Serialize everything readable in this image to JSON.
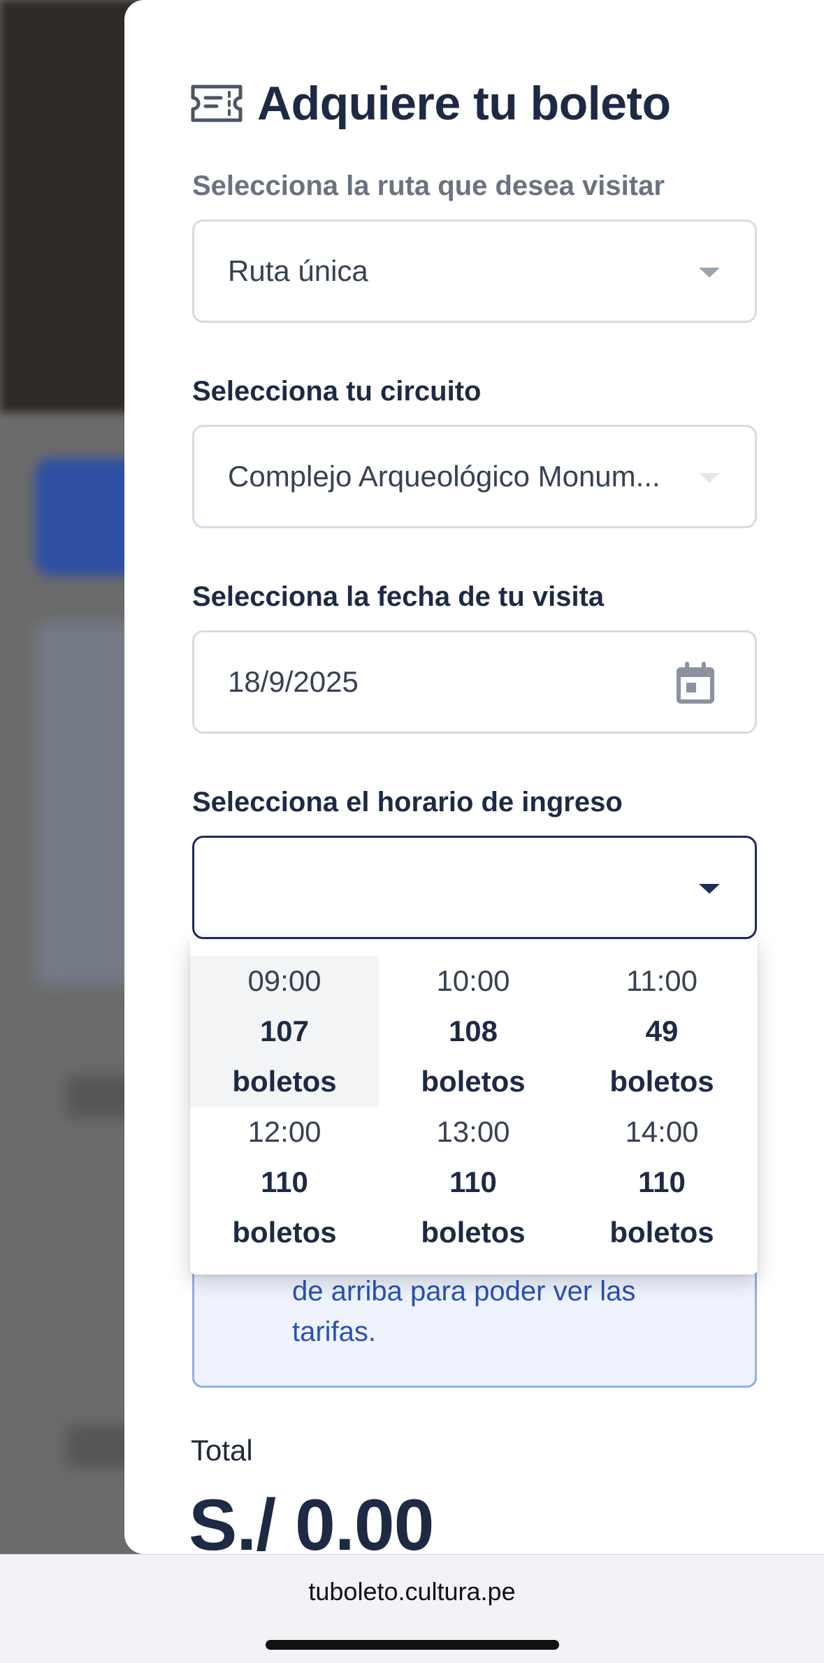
{
  "modal": {
    "title": "Adquiere tu boleto",
    "route": {
      "label": "Selecciona la ruta que desea visitar",
      "value": "Ruta única"
    },
    "circuit": {
      "label": "Selecciona tu circuito",
      "value": "Complejo Arqueológico Monum..."
    },
    "date": {
      "label": "Selecciona la fecha de tu visita",
      "value": "18/9/2025"
    },
    "schedule": {
      "label": "Selecciona el horario de ingreso",
      "value": "",
      "options": [
        {
          "time": "09:00",
          "count": "107",
          "unit": "boletos"
        },
        {
          "time": "10:00",
          "count": "108",
          "unit": "boletos"
        },
        {
          "time": "11:00",
          "count": "49",
          "unit": "boletos"
        },
        {
          "time": "12:00",
          "count": "110",
          "unit": "boletos"
        },
        {
          "time": "13:00",
          "count": "110",
          "unit": "boletos"
        },
        {
          "time": "14:00",
          "count": "110",
          "unit": "boletos"
        }
      ]
    },
    "info": {
      "text": "de arriba para poder ver las tarifas."
    },
    "total": {
      "label": "Total",
      "value": "S./ 0.00"
    }
  },
  "browser": {
    "url": "tuboleto.cultura.pe"
  },
  "colors": {
    "primary_dark": "#1e2a44",
    "info_blue": "#2b4fb8",
    "info_bg": "#eef3fd"
  }
}
